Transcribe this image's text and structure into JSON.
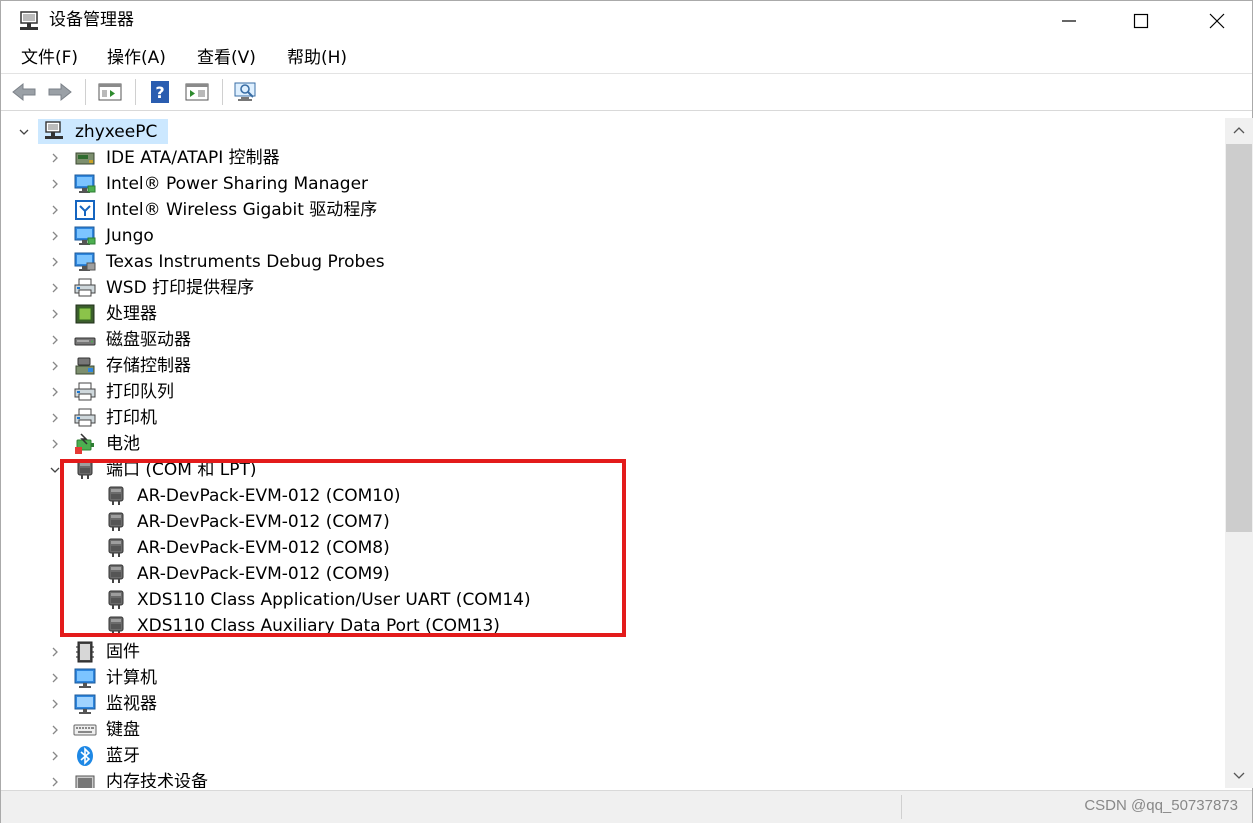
{
  "window": {
    "title": "设备管理器",
    "colors": {
      "selection": "#cce8ff",
      "highlight_box": "#e31b1b",
      "scrollbar_thumb": "#cdcdcd"
    }
  },
  "menu": [
    {
      "label": "文件(F)"
    },
    {
      "label": "操作(A)"
    },
    {
      "label": "查看(V)"
    },
    {
      "label": "帮助(H)"
    }
  ],
  "toolbar": {
    "buttons": [
      {
        "icon": "back-arrow-icon"
      },
      {
        "icon": "forward-arrow-icon"
      },
      {
        "icon": "properties-panel-icon"
      },
      {
        "icon": "help-icon"
      },
      {
        "icon": "run-panel-icon"
      },
      {
        "icon": "monitor-scan-icon"
      }
    ]
  },
  "tree": {
    "root": {
      "label": "zhyxeePC",
      "icon": "computer-network-icon",
      "expanded": true,
      "selected": true
    },
    "categories": [
      {
        "label": "IDE ATA/ATAPI 控制器",
        "icon": "ide-controller-icon"
      },
      {
        "label": "Intel® Power Sharing Manager",
        "icon": "monitor-network-icon"
      },
      {
        "label": "Intel® Wireless Gigabit 驱动程序",
        "icon": "wireless-gigabit-icon"
      },
      {
        "label": "Jungo",
        "icon": "monitor-network-icon"
      },
      {
        "label": "Texas Instruments Debug Probes",
        "icon": "debug-probe-icon"
      },
      {
        "label": "WSD 打印提供程序",
        "icon": "printer-icon"
      },
      {
        "label": "处理器",
        "icon": "processor-icon"
      },
      {
        "label": "磁盘驱动器",
        "icon": "disk-drive-icon"
      },
      {
        "label": "存储控制器",
        "icon": "storage-controller-icon"
      },
      {
        "label": "打印队列",
        "icon": "printer-icon"
      },
      {
        "label": "打印机",
        "icon": "printer-icon"
      },
      {
        "label": "电池",
        "icon": "battery-icon"
      },
      {
        "label": "端口 (COM 和 LPT)",
        "icon": "port-icon",
        "expanded": true,
        "children": [
          {
            "label": "AR-DevPack-EVM-012 (COM10)",
            "icon": "port-icon"
          },
          {
            "label": "AR-DevPack-EVM-012 (COM7)",
            "icon": "port-icon"
          },
          {
            "label": "AR-DevPack-EVM-012 (COM8)",
            "icon": "port-icon"
          },
          {
            "label": "AR-DevPack-EVM-012 (COM9)",
            "icon": "port-icon"
          },
          {
            "label": "XDS110 Class Application/User UART (COM14)",
            "icon": "port-icon"
          },
          {
            "label": "XDS110 Class Auxiliary Data Port (COM13)",
            "icon": "port-icon"
          }
        ]
      },
      {
        "label": "固件",
        "icon": "firmware-icon"
      },
      {
        "label": "计算机",
        "icon": "computer-icon"
      },
      {
        "label": "监视器",
        "icon": "monitor-icon"
      },
      {
        "label": "键盘",
        "icon": "keyboard-icon"
      },
      {
        "label": "蓝牙",
        "icon": "bluetooth-icon"
      },
      {
        "label": "内存技术设备",
        "icon": "memory-device-icon"
      }
    ]
  },
  "status": {
    "watermark": "CSDN @qq_50737873"
  }
}
